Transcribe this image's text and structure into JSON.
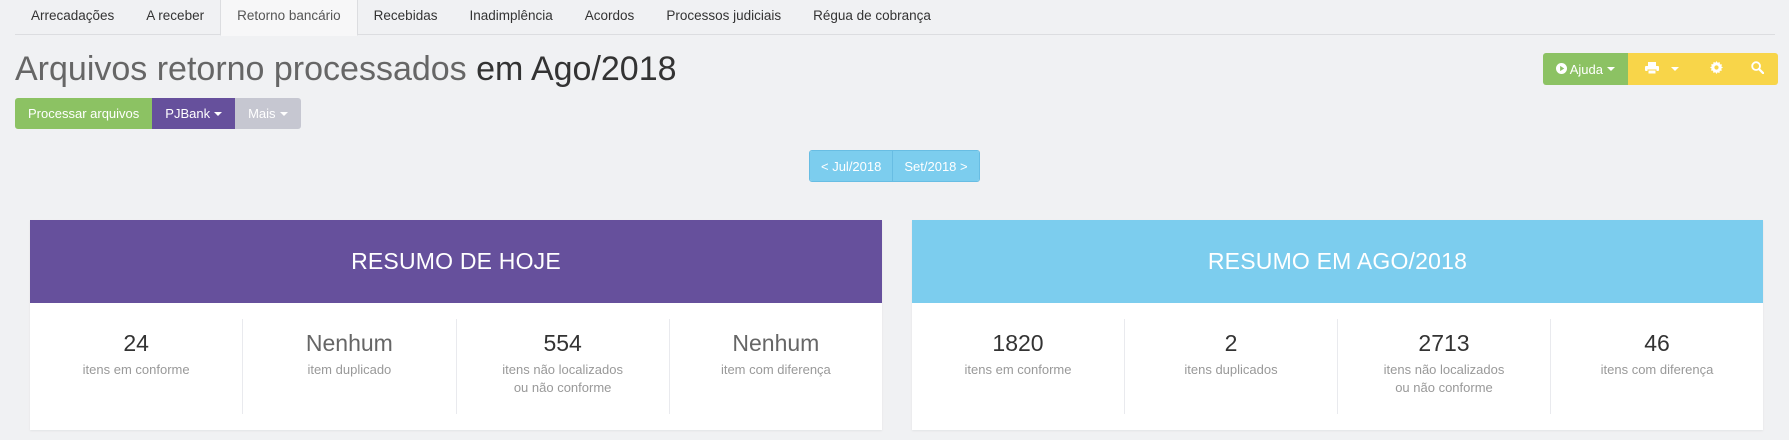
{
  "tabs": [
    {
      "label": "Arrecadações",
      "active": false
    },
    {
      "label": "A receber",
      "active": false
    },
    {
      "label": "Retorno bancário",
      "active": true
    },
    {
      "label": "Recebidas",
      "active": false
    },
    {
      "label": "Inadimplência",
      "active": false
    },
    {
      "label": "Acordos",
      "active": false
    },
    {
      "label": "Processos judiciais",
      "active": false
    },
    {
      "label": "Régua de cobrança",
      "active": false
    }
  ],
  "title": {
    "main": "Arquivos retorno processados",
    "period": "em Ago/2018"
  },
  "actions": {
    "process": "Processar arquivos",
    "bank": "PJBank",
    "more": "Mais"
  },
  "toolbar": {
    "help": "Ajuda",
    "icons": [
      "play-circle-icon",
      "print-icon",
      "gear-icon",
      "search-icon"
    ]
  },
  "month_nav": {
    "prev": "< Jul/2018",
    "next": "Set/2018 >"
  },
  "today": {
    "title": "RESUMO DE HOJE",
    "stats": [
      {
        "value": "24",
        "label": "itens em conforme"
      },
      {
        "value": "Nenhum",
        "label": "item duplicado"
      },
      {
        "value": "554",
        "label": "itens não localizados\nou não conforme"
      },
      {
        "value": "Nenhum",
        "label": "item com diferença"
      }
    ]
  },
  "month": {
    "title": "RESUMO EM AGO/2018",
    "stats": [
      {
        "value": "1820",
        "label": "itens em conforme"
      },
      {
        "value": "2",
        "label": "itens duplicados"
      },
      {
        "value": "2713",
        "label": "itens não localizados\nou não conforme"
      },
      {
        "value": "46",
        "label": "itens com diferença"
      }
    ]
  },
  "colors": {
    "purple": "#66509c",
    "blue": "#7ccdee",
    "green": "#8cc263",
    "yellow": "#f8d549",
    "grey": "#c6c7d1"
  }
}
